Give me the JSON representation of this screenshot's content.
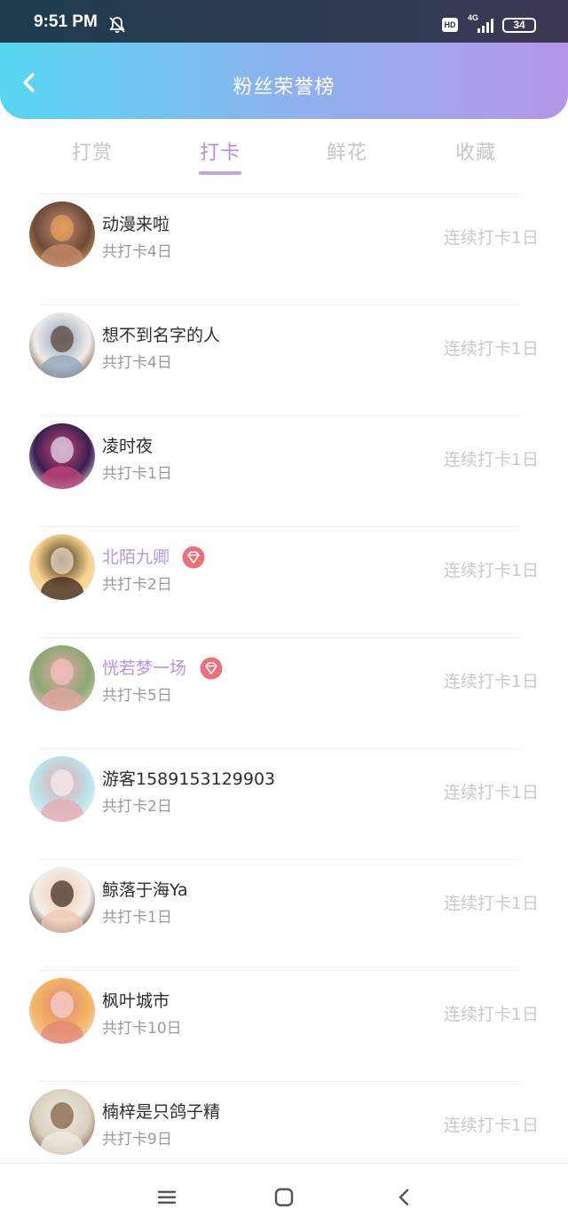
{
  "status_bar": {
    "time": "9:51 PM",
    "hd": "HD",
    "network": "4G",
    "battery": "34"
  },
  "header": {
    "title": "粉丝荣誉榜"
  },
  "tabs": [
    {
      "label": "打赏",
      "active": false
    },
    {
      "label": "打卡",
      "active": true
    },
    {
      "label": "鲜花",
      "active": false
    },
    {
      "label": "收藏",
      "active": false
    }
  ],
  "list": [
    {
      "name": "动漫来啦",
      "total": "共打卡4日",
      "streak": "连续打卡1日",
      "vip": false,
      "avatar_colors": [
        "#6b4a3a",
        "#e9a35a",
        "#c98c6e"
      ]
    },
    {
      "name": "想不到名字的人",
      "total": "共打卡4日",
      "streak": "连续打卡1日",
      "vip": false,
      "avatar_colors": [
        "#f1ece9",
        "#5a4032",
        "#8ca3b8"
      ]
    },
    {
      "name": "凌时夜",
      "total": "共打卡1日",
      "streak": "连续打卡1日",
      "vip": false,
      "avatar_colors": [
        "#3b1f4e",
        "#e2e2f2",
        "#c9477b"
      ]
    },
    {
      "name": "北陌九卿",
      "total": "共打卡2日",
      "streak": "连续打卡1日",
      "vip": true,
      "avatar_colors": [
        "#f7d38c",
        "#f3e6d0",
        "#3a2418"
      ]
    },
    {
      "name": "恍若梦一场",
      "total": "共打卡5日",
      "streak": "连续打卡1日",
      "vip": true,
      "avatar_colors": [
        "#8aa873",
        "#f3c3c2",
        "#eaa6a5"
      ]
    },
    {
      "name": "游客1589153129903",
      "total": "共打卡2日",
      "streak": "连续打卡1日",
      "vip": false,
      "avatar_colors": [
        "#b9e3ea",
        "#f4f4f4",
        "#e9a7b2"
      ]
    },
    {
      "name": "鲸落于海Ya",
      "total": "共打卡1日",
      "streak": "连续打卡1日",
      "vip": false,
      "avatar_colors": [
        "#f4efe9",
        "#3a2620",
        "#f0c6b0"
      ]
    },
    {
      "name": "枫叶城市",
      "total": "共打卡10日",
      "streak": "连续打卡1日",
      "vip": false,
      "avatar_colors": [
        "#f3b563",
        "#f7d6d4",
        "#e3857a"
      ]
    },
    {
      "name": "楠梓是只鸽子精",
      "total": "共打卡9日",
      "streak": "连续打卡1日",
      "vip": false,
      "avatar_colors": [
        "#d8cfbe",
        "#7a5a3a",
        "#f1ebe1"
      ]
    }
  ],
  "colors": {
    "accent": "#b596e0",
    "header_start": "#56d7f1",
    "header_end": "#b596e9",
    "vip_badge": "#ef6f78"
  }
}
